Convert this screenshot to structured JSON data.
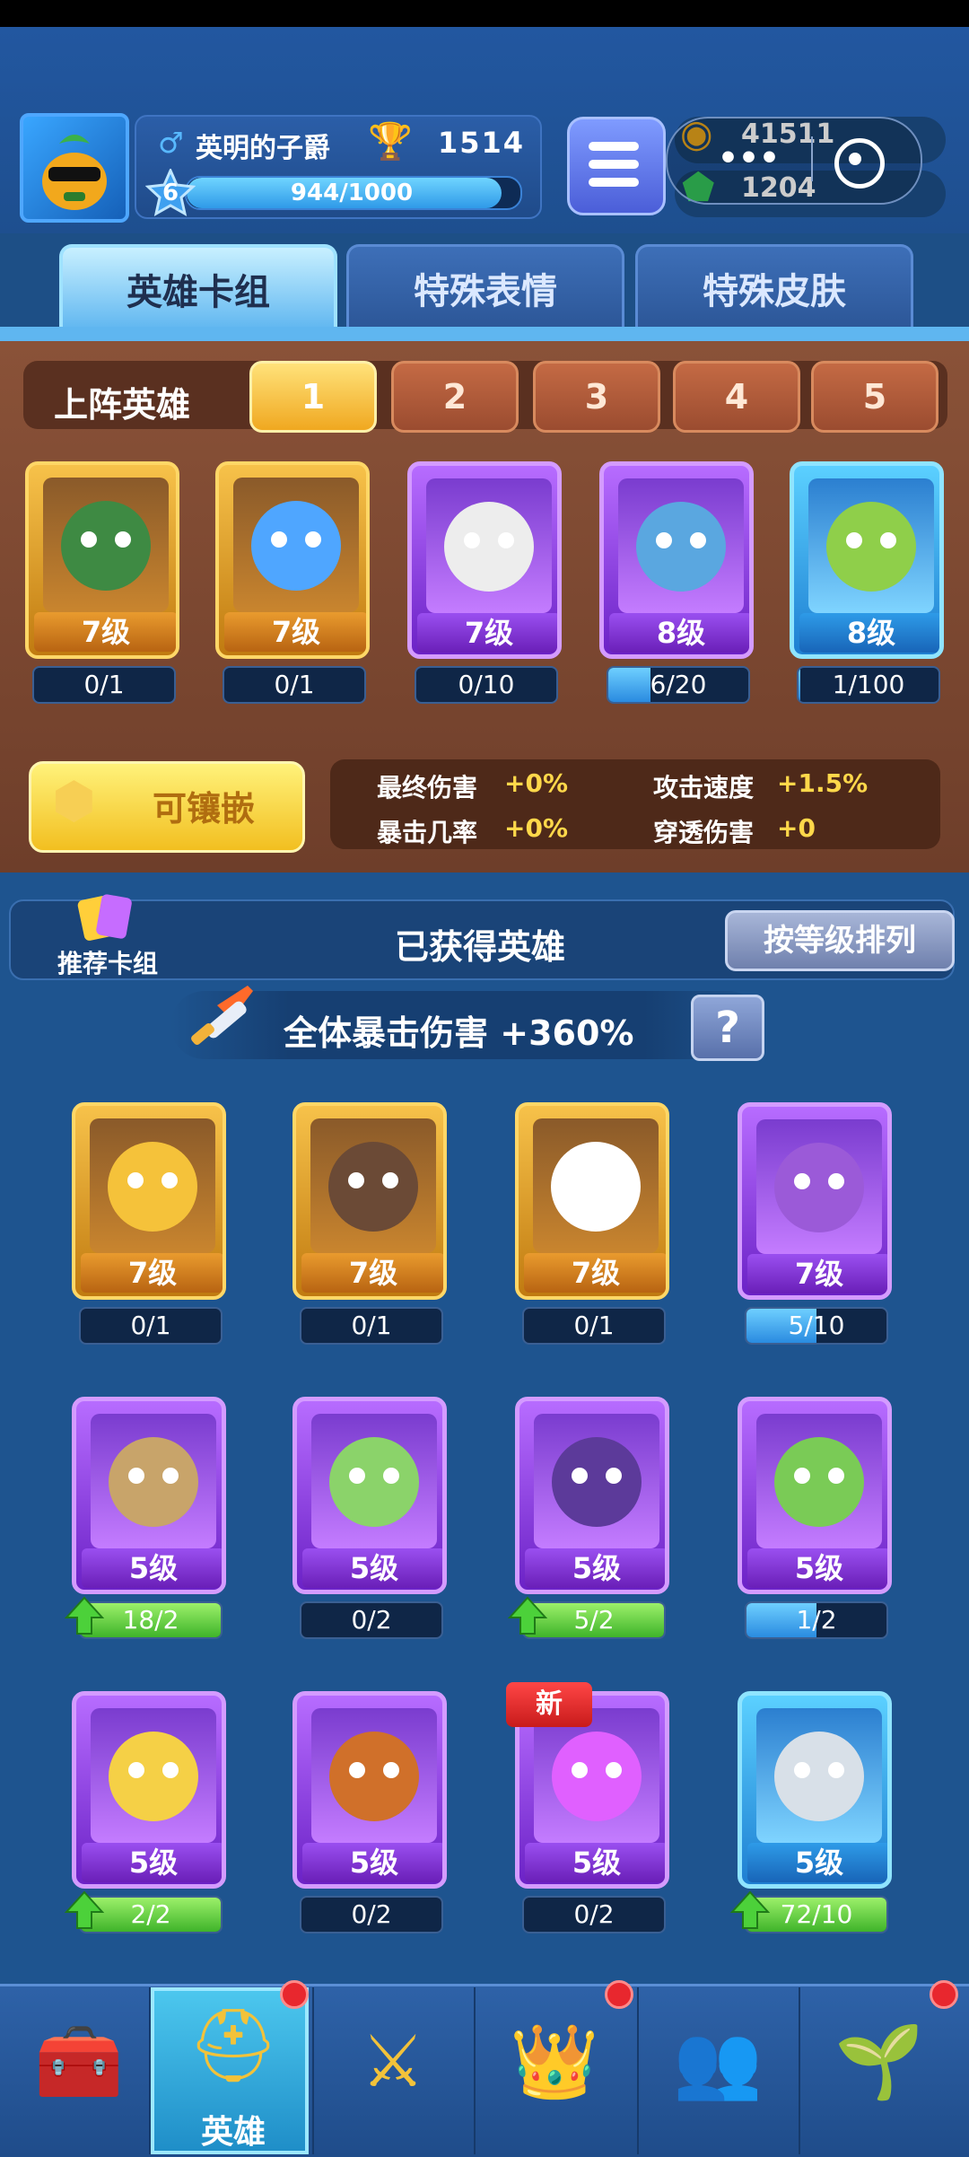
{
  "player": {
    "name": "英明的子爵",
    "trophies": "1514",
    "level": "6",
    "xp_text": "944/1000",
    "xp_fraction": 0.944
  },
  "resources": {
    "coins": "41511",
    "gems": "1204"
  },
  "tabs": [
    {
      "label": "英雄卡组",
      "active": true
    },
    {
      "label": "特殊表情",
      "active": false
    },
    {
      "label": "特殊皮肤",
      "active": false
    }
  ],
  "deck": {
    "title": "上阵英雄",
    "slots": [
      "1",
      "2",
      "3",
      "4",
      "5"
    ],
    "active_slot": "1",
    "cards": [
      {
        "rarity": "gold",
        "level": "7级",
        "progress": "0/1",
        "fill": 0
      },
      {
        "rarity": "gold",
        "level": "7级",
        "progress": "0/1",
        "fill": 0
      },
      {
        "rarity": "purple",
        "level": "7级",
        "progress": "0/10",
        "fill": 0
      },
      {
        "rarity": "purple",
        "level": "8级",
        "progress": "6/20",
        "fill": 0.3
      },
      {
        "rarity": "blue",
        "level": "8级",
        "progress": "1/100",
        "fill": 0.01
      }
    ]
  },
  "inlay_button": "可镶嵌",
  "bonuses": [
    {
      "label": "最终伤害",
      "value": "+0%"
    },
    {
      "label": "攻击速度",
      "value": "+1.5%"
    },
    {
      "label": "暴击几率",
      "value": "+0%"
    },
    {
      "label": "穿透伤害",
      "value": "+0"
    }
  ],
  "collection": {
    "recommend_label": "推荐卡组",
    "title": "已获得英雄",
    "sort_label": "按等级排列",
    "crit_text": "全体暴击伤害 +360%",
    "help": "?",
    "cards": [
      {
        "rarity": "gold",
        "level": "7级",
        "progress": "0/1",
        "fill": 0,
        "upgrade": false,
        "new": false
      },
      {
        "rarity": "gold",
        "level": "7级",
        "progress": "0/1",
        "fill": 0,
        "upgrade": false,
        "new": false
      },
      {
        "rarity": "gold",
        "level": "7级",
        "progress": "0/1",
        "fill": 0,
        "upgrade": false,
        "new": false
      },
      {
        "rarity": "purple",
        "level": "7级",
        "progress": "5/10",
        "fill": 0.5,
        "upgrade": false,
        "new": false
      },
      {
        "rarity": "purple",
        "level": "5级",
        "progress": "18/2",
        "fill": 1,
        "upgrade": true,
        "new": false
      },
      {
        "rarity": "purple",
        "level": "5级",
        "progress": "0/2",
        "fill": 0,
        "upgrade": false,
        "new": false
      },
      {
        "rarity": "purple",
        "level": "5级",
        "progress": "5/2",
        "fill": 1,
        "upgrade": true,
        "new": false
      },
      {
        "rarity": "purple",
        "level": "5级",
        "progress": "1/2",
        "fill": 0.5,
        "upgrade": false,
        "new": false
      },
      {
        "rarity": "purple",
        "level": "5级",
        "progress": "2/2",
        "fill": 1,
        "upgrade": true,
        "new": false
      },
      {
        "rarity": "purple",
        "level": "5级",
        "progress": "0/2",
        "fill": 0,
        "upgrade": false,
        "new": false
      },
      {
        "rarity": "purple",
        "level": "5级",
        "progress": "0/2",
        "fill": 0,
        "upgrade": false,
        "new": true
      },
      {
        "rarity": "blue",
        "level": "5级",
        "progress": "72/10",
        "fill": 1,
        "upgrade": true,
        "new": false
      }
    ],
    "new_badge": "新"
  },
  "nav": {
    "items": [
      {
        "icon": "treasure-chest-icon",
        "label": "",
        "active": false,
        "dot": false
      },
      {
        "icon": "knight-helmet-icon",
        "label": "英雄",
        "active": true,
        "dot": true
      },
      {
        "icon": "crossed-swords-icon",
        "label": "",
        "active": false,
        "dot": false
      },
      {
        "icon": "crown-shield-icon",
        "label": "",
        "active": false,
        "dot": true
      },
      {
        "icon": "team-banner-icon",
        "label": "",
        "active": false,
        "dot": false
      },
      {
        "icon": "sprout-island-icon",
        "label": "",
        "active": false,
        "dot": true
      }
    ]
  },
  "colors": {
    "gold": "#f2b23a",
    "purple": "#9a4ff0",
    "blue": "#2e9be8",
    "bonus_value": "#ffd84a"
  }
}
